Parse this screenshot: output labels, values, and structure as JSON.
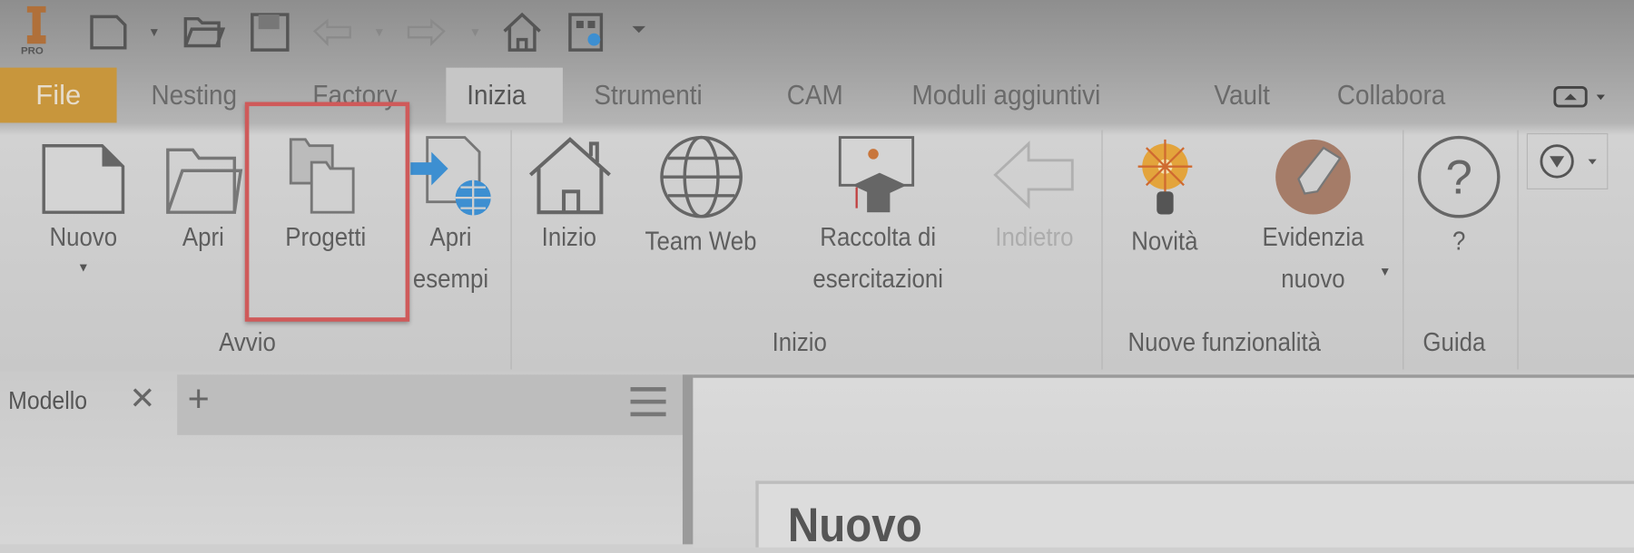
{
  "app": {
    "logo_text": "PRO"
  },
  "quick_access": {
    "icons": [
      "app-logo-icon",
      "new-file-icon",
      "open-folder-icon",
      "save-icon",
      "undo-icon",
      "redo-icon",
      "home-icon",
      "qr-code-icon",
      "customize-dropdown-icon"
    ]
  },
  "tabs": [
    {
      "label": "File"
    },
    {
      "label": "Nesting"
    },
    {
      "label": "Factory"
    },
    {
      "label": "Inizia",
      "active": true
    },
    {
      "label": "Strumenti"
    },
    {
      "label": "CAM"
    },
    {
      "label": "Moduli aggiuntivi"
    },
    {
      "label": "Vault"
    },
    {
      "label": "Collabora"
    }
  ],
  "ribbon": {
    "groups": [
      {
        "label": "Avvio",
        "buttons": [
          {
            "label": "Nuovo"
          },
          {
            "label": "Apri"
          },
          {
            "label": "Progetti",
            "highlighted": true
          },
          {
            "label_line1": "Apri",
            "label_line2": "esempi"
          }
        ]
      },
      {
        "label": "Inizio",
        "buttons": [
          {
            "label": "Inizio"
          },
          {
            "label": "Team Web"
          },
          {
            "label_line1": "Raccolta di",
            "label_line2": "esercitazioni"
          },
          {
            "label": "Indietro",
            "disabled": true
          }
        ]
      },
      {
        "label": "Nuove funzionalità",
        "buttons": [
          {
            "label": "Novità"
          },
          {
            "label_line1": "Evidenzia",
            "label_line2": "nuovo"
          }
        ]
      },
      {
        "label": "Guida",
        "buttons": [
          {
            "label": "?"
          }
        ]
      }
    ]
  },
  "panel": {
    "tab_label": "Modello"
  },
  "main": {
    "heading": "Nuovo"
  },
  "colors": {
    "file_tab": "#c8963c",
    "highlight_box": "#cf5a5a",
    "accent_blue": "#3d8fd1"
  }
}
